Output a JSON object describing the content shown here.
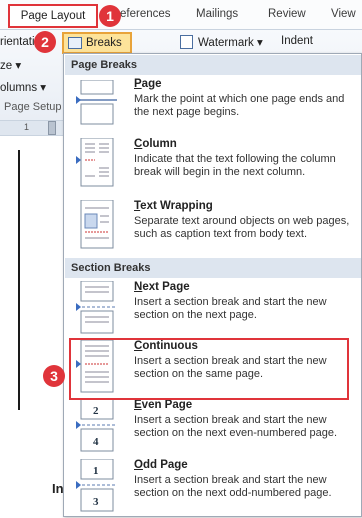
{
  "ribbon": {
    "active_tab": "Page Layout",
    "tabs": [
      "eferences",
      "Mailings",
      "Review",
      "View"
    ],
    "orientation_label": "rientatio",
    "size_label": "ze ▾",
    "columns_label": "olumns ▾",
    "breaks_label": "Breaks ▾",
    "watermark_label": "Watermark ▾",
    "indent_label": "Indent",
    "group_label": "Page Setup",
    "ruler_mark": "1"
  },
  "markers": [
    "1",
    "2",
    "3"
  ],
  "document": {
    "partial_text": "In"
  },
  "menu": {
    "sections": [
      {
        "header": "Page Breaks",
        "items": [
          {
            "key": "P",
            "rest": "age",
            "desc": "Mark the point at which one page ends and the next page begins."
          },
          {
            "key": "C",
            "rest": "olumn",
            "desc": "Indicate that the text following the column break will begin in the next column."
          },
          {
            "key": "T",
            "rest": "ext Wrapping",
            "desc": "Separate text around objects on web pages, such as caption text from body text."
          }
        ]
      },
      {
        "header": "Section Breaks",
        "items": [
          {
            "key": "N",
            "rest": "ext Page",
            "desc": "Insert a section break and start the new section on the next page."
          },
          {
            "key": "C",
            "rest": "ontinuous",
            "desc": "Insert a section break and start the new section on the same page."
          },
          {
            "key": "E",
            "rest": "ven Page",
            "desc": "Insert a section break and start the new section on the next even-numbered page."
          },
          {
            "key": "O",
            "rest": "dd Page",
            "desc": "Insert a section break and start the new section on the next odd-numbered page."
          }
        ]
      }
    ]
  },
  "colors": {
    "highlight": "#e0343a",
    "breaks_bg": "#fde39a",
    "section_bg": "#dde5ef"
  }
}
